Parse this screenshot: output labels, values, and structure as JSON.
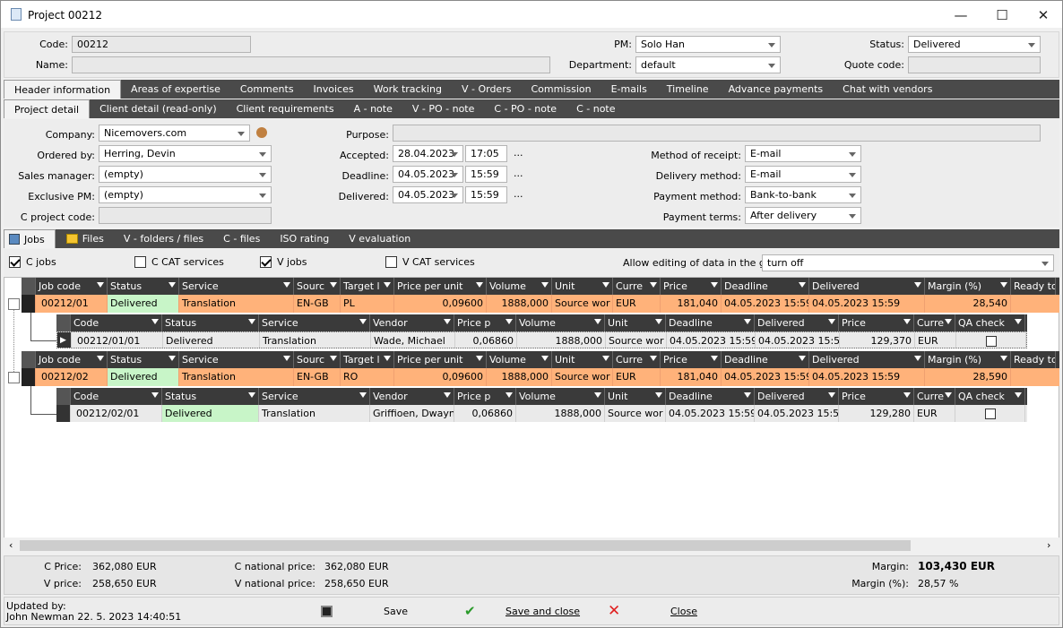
{
  "window": {
    "title": "Project 00212",
    "min": "—",
    "max": "☐",
    "close": "✕"
  },
  "header": {
    "code_label": "Code:",
    "code": "00212",
    "name_label": "Name:",
    "name": "",
    "pm_label": "PM:",
    "pm": "Solo Han",
    "department_label": "Department:",
    "department": "default",
    "status_label": "Status:",
    "status": "Delivered",
    "quote_code_label": "Quote code:",
    "quote_code": ""
  },
  "tabs1": [
    "Header information",
    "Areas of expertise",
    "Comments",
    "Invoices",
    "Work tracking",
    "V - Orders",
    "Commission",
    "E-mails",
    "Timeline",
    "Advance payments",
    "Chat with vendors"
  ],
  "tabs2": [
    "Project detail",
    "Client detail (read-only)",
    "Client requirements",
    "A - note",
    "V - PO - note",
    "C - PO - note",
    "C - note"
  ],
  "detail": {
    "company_label": "Company:",
    "company": "Nicemovers.com",
    "ordered_by_label": "Ordered by:",
    "ordered_by": "Herring, Devin",
    "sales_manager_label": "Sales manager:",
    "sales_manager": "(empty)",
    "exclusive_pm_label": "Exclusive PM:",
    "exclusive_pm": "(empty)",
    "c_project_code_label": "C project code:",
    "c_project_code": "",
    "purpose_label": "Purpose:",
    "purpose": "",
    "accepted_label": "Accepted:",
    "accepted_date": "28.04.2023",
    "accepted_time": "17:05",
    "deadline_label": "Deadline:",
    "deadline_date": "04.05.2023",
    "deadline_time": "15:59",
    "delivered_label": "Delivered:",
    "delivered_date": "04.05.2023",
    "delivered_time": "15:59",
    "ellipsis": "...",
    "method_of_receipt_label": "Method of receipt:",
    "method_of_receipt": "E-mail",
    "delivery_method_label": "Delivery method:",
    "delivery_method": "E-mail",
    "payment_method_label": "Payment method:",
    "payment_method": "Bank-to-bank",
    "payment_terms_label": "Payment terms:",
    "payment_terms": "After delivery"
  },
  "tabs3": [
    "Jobs",
    "Files",
    "V - folders / files",
    "C - files",
    "ISO rating",
    "V evaluation"
  ],
  "filters": {
    "c_jobs": "C jobs",
    "c_cat": "C CAT services",
    "v_jobs": "V jobs",
    "v_cat": "V CAT services",
    "allow_label": "Allow editing of data in the grid:",
    "allow_value": "turn off"
  },
  "job_cols": [
    "Job code",
    "Status",
    "Service",
    "Sourc",
    "Target l",
    "Price per unit",
    "Volume",
    "Unit",
    "Curre",
    "Price",
    "Deadline",
    "Delivered",
    "Margin (%)",
    "Ready to"
  ],
  "sub_cols": [
    "Code",
    "Status",
    "Service",
    "Vendor",
    "Price p",
    "Volume",
    "Unit",
    "Deadline",
    "Delivered",
    "Price",
    "Curre",
    "QA check"
  ],
  "jobs": [
    {
      "code": "00212/01",
      "status": "Delivered",
      "service": "Translation",
      "source": "EN-GB",
      "target": "PL",
      "ppu": "0,09600",
      "volume": "1888,000",
      "unit": "Source wor",
      "currency": "EUR",
      "price": "181,040",
      "deadline": "04.05.2023 15:59",
      "delivered": "04.05.2023 15:59",
      "margin": "28,540",
      "sub": {
        "code": "00212/01/01",
        "status": "Delivered",
        "service": "Translation",
        "vendor": "Wade, Michael",
        "pp": "0,06860",
        "volume": "1888,000",
        "unit": "Source wor",
        "deadline": "04.05.2023 15:59",
        "delivered": "04.05.2023 15:5",
        "price": "129,370",
        "currency": "EUR"
      }
    },
    {
      "code": "00212/02",
      "status": "Delivered",
      "service": "Translation",
      "source": "EN-GB",
      "target": "RO",
      "ppu": "0,09600",
      "volume": "1888,000",
      "unit": "Source wor",
      "currency": "EUR",
      "price": "181,040",
      "deadline": "04.05.2023 15:59",
      "delivered": "04.05.2023 15:59",
      "margin": "28,590",
      "sub": {
        "code": "00212/02/01",
        "status": "Delivered",
        "service": "Translation",
        "vendor": "Griffioen, Dwayn",
        "pp": "0,06860",
        "volume": "1888,000",
        "unit": "Source wor",
        "deadline": "04.05.2023 15:59",
        "delivered": "04.05.2023 15:5",
        "price": "129,280",
        "currency": "EUR"
      }
    }
  ],
  "totals": {
    "c_price_label": "C Price:",
    "c_price": "362,080 EUR",
    "v_price_label": "V price:",
    "v_price": "258,650 EUR",
    "c_nat_label": "C national price:",
    "c_nat": "362,080 EUR",
    "v_nat_label": "V national price:",
    "v_nat": "258,650 EUR",
    "margin_label": "Margin:",
    "margin": "103,430 EUR",
    "margin_pct_label": "Margin (%):",
    "margin_pct": "28,57 %"
  },
  "footer": {
    "updated_by": "Updated by:",
    "updated_info": "John Newman 22. 5. 2023 14:40:51",
    "save": "Save",
    "save_close": "Save and close",
    "close": "Close"
  },
  "colors": {
    "orange_row": "#ffb27a",
    "green_status": "#c8f5c8",
    "dark_bar": "#4a4a4a"
  }
}
